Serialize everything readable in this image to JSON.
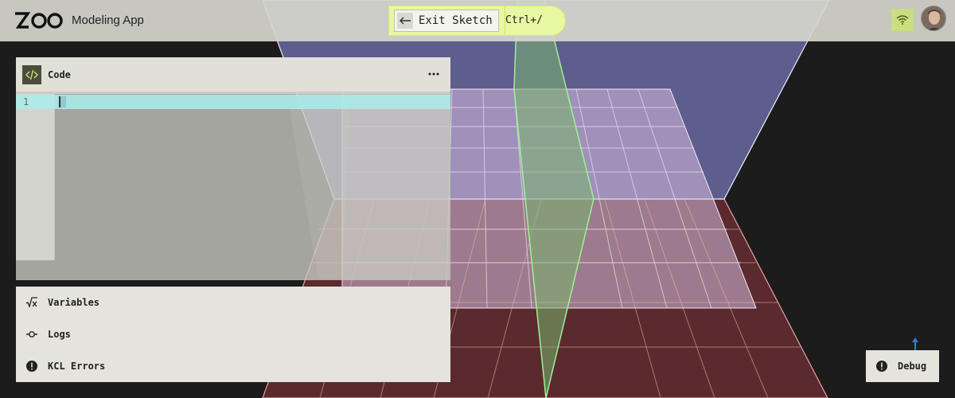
{
  "header": {
    "logo_text": "ZOO",
    "app_name": "Modeling App",
    "exit_sketch_label": "Exit Sketch",
    "exit_sketch_shortcut": "Ctrl+/",
    "network_icon": "wifi-icon",
    "avatar_icon": "user-avatar"
  },
  "code_pane": {
    "title": "Code",
    "icon": "code-brackets-icon",
    "menu_icon": "more-horizontal-icon",
    "line_numbers": [
      "1"
    ],
    "content": ""
  },
  "panels": [
    {
      "label": "Variables",
      "icon": "sqrt-x-icon"
    },
    {
      "label": "Logs",
      "icon": "commit-dot-icon"
    },
    {
      "label": "KCL Errors",
      "icon": "alert-circle-icon"
    }
  ],
  "debug": {
    "label": "Debug",
    "icon": "alert-circle-icon"
  },
  "colors": {
    "accent": "#e8f7a2",
    "accent_border": "#d6ec6e",
    "network_button": "#c9de7e",
    "active_line": "#aaecea",
    "xy_plane": "#8a8fd6",
    "xz_plane": "#d98b8b",
    "yz_plane": "#8fdc8a",
    "background": "#1c1c1c",
    "axis_indicator": "#2a7fd4"
  }
}
